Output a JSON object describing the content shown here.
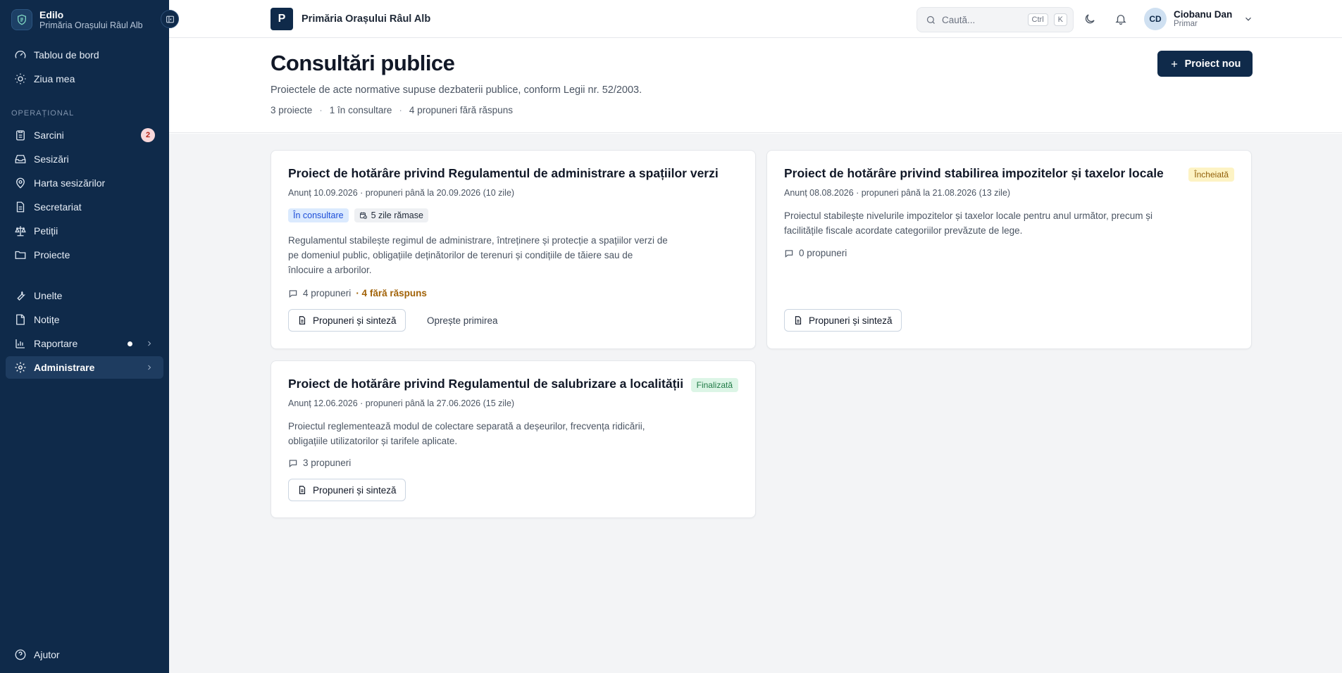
{
  "sidebar": {
    "brand_name": "Edilo",
    "brand_sub": "Primăria Orașului Râul Alb",
    "top_items": [
      {
        "label": "Tablou de bord",
        "icon": "gauge-icon"
      },
      {
        "label": "Ziua mea",
        "icon": "sun-icon"
      }
    ],
    "section_label": "OPERAȚIONAL",
    "op_items": [
      {
        "label": "Sarcini",
        "icon": "clipboard-icon",
        "badge": "2"
      },
      {
        "label": "Sesizări",
        "icon": "inbox-icon"
      },
      {
        "label": "Harta sesizărilor",
        "icon": "map-pin-icon"
      },
      {
        "label": "Secretariat",
        "icon": "document-icon"
      },
      {
        "label": "Petiții",
        "icon": "scale-icon"
      },
      {
        "label": "Proiecte",
        "icon": "folder-icon"
      }
    ],
    "tool_items": [
      {
        "label": "Unelte",
        "icon": "wrench-icon"
      },
      {
        "label": "Notițe",
        "icon": "note-icon"
      },
      {
        "label": "Raportare",
        "icon": "chart-icon"
      },
      {
        "label": "Administrare",
        "icon": "gear-icon",
        "active": true
      }
    ],
    "help_label": "Ajutor"
  },
  "topbar": {
    "org_initial": "P",
    "org_name": "Primăria Orașului Râul Alb",
    "search_placeholder": "Caută...",
    "kbd_ctrl": "Ctrl",
    "kbd_k": "K",
    "user_initials": "CD",
    "user_name": "Ciobanu Dan",
    "user_role": "Primar"
  },
  "page": {
    "title": "Consultări publice",
    "description": "Proiectele de acte normative supuse dezbaterii publice, conform Legii nr. 52/2003.",
    "stats": [
      "3 proiecte",
      "1 în consultare",
      "4 propuneri fără răspuns"
    ],
    "stat_sep": "·",
    "new_button": "Proiect nou"
  },
  "cards": [
    {
      "title": "Proiect de hotărâre privind Regulamentul de administrare a spațiilor verzi",
      "meta": "Anunț 10.09.2026 · propuneri până la 20.09.2026 (10 zile)",
      "tag_status": "În consultare",
      "tag_days": "5 zile rămase",
      "body": "Regulamentul stabilește regimul de administrare, întreținere și protecție a spațiilor verzi de pe domeniul public, obligațiile deținătorilor de terenuri și condițiile de tăiere sau de înlocuire a arborilor.",
      "count": "4 propuneri",
      "count_warn": "· 4 fără răspuns",
      "button": "Propuneri și sinteză",
      "secondary": "Oprește primirea"
    },
    {
      "title": "Proiect de hotărâre privind stabilirea impozitelor și taxelor locale",
      "status": "Încheiată",
      "meta": "Anunț 08.08.2026 · propuneri până la 21.08.2026 (13 zile)",
      "body": "Proiectul stabilește nivelurile impozitelor și taxelor locale pentru anul următor, precum și facilitățile fiscale acordate categoriilor prevăzute de lege.",
      "count": "0 propuneri",
      "button": "Propuneri și sinteză"
    },
    {
      "title": "Proiect de hotărâre privind Regulamentul de salubrizare a localității",
      "status": "Finalizată",
      "meta": "Anunț 12.06.2026 · propuneri până la 27.06.2026 (15 zile)",
      "body": "Proiectul reglementează modul de colectare separată a deșeurilor, frecvența ridicării, obligațiile utilizatorilor și tarifele aplicate.",
      "count": "3 propuneri",
      "button": "Propuneri și sinteză"
    }
  ],
  "colors": {
    "sidebar_bg": "#0f2a4a",
    "accent": "#0f2a4a",
    "status_consult": "#dbeafe",
    "status_closed": "#fdf3c4",
    "status_done": "#dcf5e6",
    "warn": "#a16207"
  }
}
